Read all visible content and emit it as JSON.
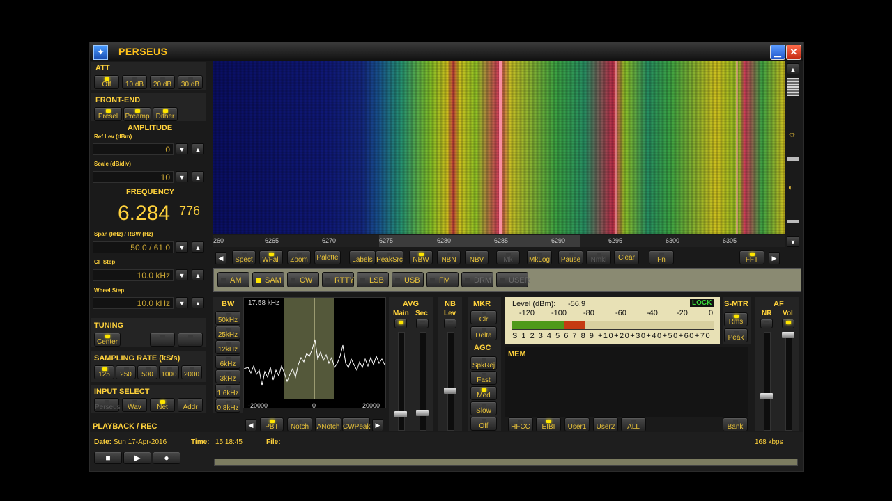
{
  "app": {
    "title": "PERSEUS",
    "icon": "perseus-icon"
  },
  "att": {
    "label": "ATT",
    "buttons": [
      {
        "label": "Off",
        "on": true
      },
      {
        "label": "10 dB",
        "on": false
      },
      {
        "label": "20 dB",
        "on": false
      },
      {
        "label": "30 dB",
        "on": false
      }
    ]
  },
  "frontend": {
    "label": "FRONT-END",
    "buttons": [
      {
        "label": "Presel",
        "on": true
      },
      {
        "label": "Preamp",
        "on": true
      },
      {
        "label": "Dither",
        "on": true
      }
    ]
  },
  "amplitude": {
    "label": "AMPLITUDE",
    "ref_label": "Ref Lev (dBm)",
    "ref_value": "0",
    "scale_label": "Scale (dB/div)",
    "scale_value": "10"
  },
  "frequency": {
    "label": "FREQUENCY",
    "main": "6.284",
    "sub": "776",
    "span_label": "Span (kHz) / RBW (Hz)",
    "span_value": "50.0 / 61.0",
    "cf_label": "CF Step",
    "cf_value": "10.0 kHz",
    "wheel_label": "Wheel Step",
    "wheel_value": "10.0 kHz"
  },
  "tuning": {
    "label": "TUNING",
    "center": "Center"
  },
  "sampling": {
    "label": "SAMPLING RATE (kS/s)",
    "rates": [
      {
        "label": "125",
        "on": true
      },
      {
        "label": "250",
        "on": false
      },
      {
        "label": "500",
        "on": false
      },
      {
        "label": "1000",
        "on": false
      },
      {
        "label": "2000",
        "on": false
      }
    ]
  },
  "input": {
    "label": "INPUT SELECT",
    "buttons": [
      {
        "label": "Perseus",
        "on": false,
        "dim": true
      },
      {
        "label": "Wav",
        "on": false
      },
      {
        "label": "Net",
        "on": true
      },
      {
        "label": "Addr",
        "on": false
      }
    ]
  },
  "playback": {
    "label": "PLAYBACK / REC"
  },
  "scale_ticks": [
    "260",
    "6265",
    "6270",
    "6275",
    "6280",
    "6285",
    "6290",
    "6295",
    "6300",
    "6305"
  ],
  "toolbar": [
    {
      "label": "Spect",
      "on": false
    },
    {
      "label": "WFall",
      "on": true
    },
    {
      "label": "Zoom",
      "on": false
    },
    {
      "label": "Palette",
      "on": false
    },
    {
      "label": "Labels",
      "on": false
    },
    {
      "label": "PeakSrc",
      "on": false
    },
    {
      "label": "NBW",
      "on": true
    },
    {
      "label": "NBN",
      "on": false
    },
    {
      "label": "NBV",
      "on": false
    },
    {
      "label": "Mk",
      "on": false,
      "dim": true
    },
    {
      "label": "MkLog",
      "on": false
    },
    {
      "label": "Pause",
      "on": false
    },
    {
      "label": "Nmkl",
      "on": false,
      "dim": true
    },
    {
      "label": "Clear",
      "on": false
    },
    {
      "label": "Fn",
      "on": false
    },
    {
      "label": "FFT",
      "on": true
    }
  ],
  "modes": [
    {
      "label": "AM",
      "on": false
    },
    {
      "label": "SAM",
      "on": true
    },
    {
      "label": "CW",
      "on": false
    },
    {
      "label": "RTTY",
      "on": false
    },
    {
      "label": "LSB",
      "on": false
    },
    {
      "label": "USB",
      "on": false
    },
    {
      "label": "FM",
      "on": false
    },
    {
      "label": "DRM",
      "on": false,
      "dim": true
    },
    {
      "label": "USER",
      "on": false,
      "dim": true
    }
  ],
  "bw": {
    "label": "BW",
    "value": "17.58 kHz",
    "buttons": [
      "50kHz",
      "25kHz",
      "12kHz",
      "6kHz",
      "3kHz",
      "1.6kHz",
      "0.8kHz"
    ],
    "axis": [
      "-20000",
      "0",
      "20000"
    ]
  },
  "avg": {
    "label": "AVG",
    "main": "Main",
    "sec": "Sec"
  },
  "nb": {
    "label": "NB",
    "lev": "Lev"
  },
  "mkr": {
    "label": "MKR",
    "clr": "Clr",
    "delta": "Delta"
  },
  "agc": {
    "label": "AGC",
    "buttons": [
      "SpkRej",
      "Fast",
      "Med",
      "Slow",
      "Off"
    ]
  },
  "bottom_buttons": [
    "PBT",
    "Notch",
    "ANotch",
    "CWPeak"
  ],
  "meter": {
    "level_label": "Level (dBm):",
    "level_value": "-56.9",
    "lock": "LOCK",
    "db_scale": [
      "-120",
      "-100",
      "-80",
      "-60",
      "-40",
      "-20",
      "0"
    ],
    "s_scale": "S 1 2 3 4 5 6 7 8 9 +10+20+30+40+50+60+70",
    "fill_fraction": 0.36,
    "colors": {
      "green": "#4f9a1a",
      "red": "#c53a12"
    }
  },
  "smtr": {
    "label": "S-MTR",
    "rms": "Rms",
    "peak": "Peak"
  },
  "af": {
    "label": "AF",
    "nr": "NR",
    "vol": "Vol"
  },
  "mem": {
    "label": "MEM",
    "buttons": [
      "HFCC",
      "EIBI",
      "User1",
      "User2",
      "ALL"
    ],
    "bank": "Bank"
  },
  "status": {
    "date_label": "Date:",
    "date_value": "Sun 17-Apr-2016",
    "time_label": "Time:",
    "time_value": "15:18:45",
    "file_label": "File:",
    "bitrate": "168 kbps"
  }
}
